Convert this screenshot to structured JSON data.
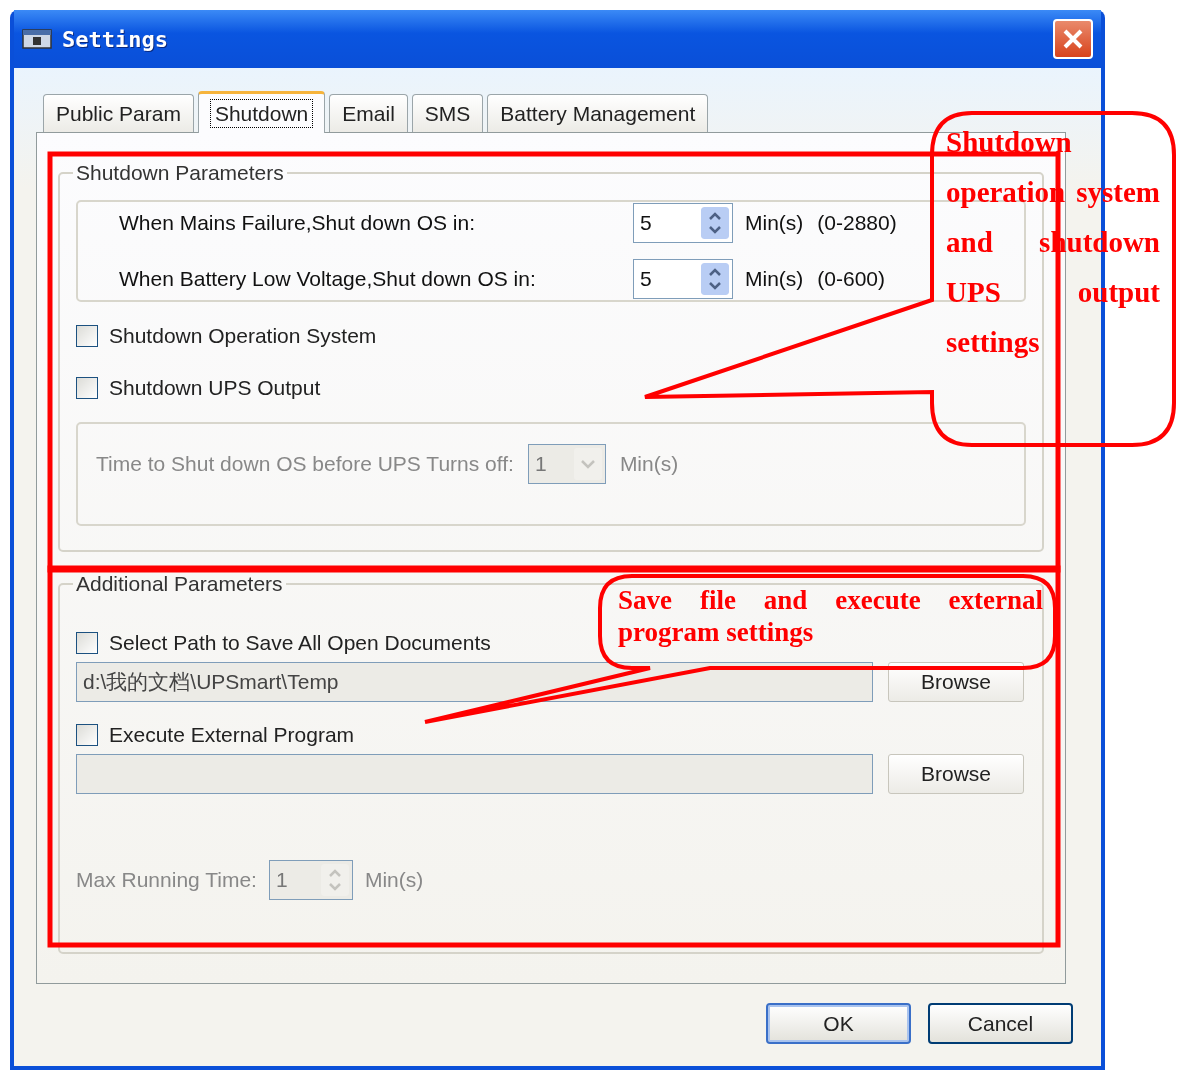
{
  "window": {
    "title": "Settings"
  },
  "tabs": [
    {
      "label": "Public Param",
      "selected": false
    },
    {
      "label": "Shutdown",
      "selected": true
    },
    {
      "label": "Email",
      "selected": false
    },
    {
      "label": "SMS",
      "selected": false
    },
    {
      "label": "Battery Management",
      "selected": false
    }
  ],
  "shutdown_parameters": {
    "title": "Shutdown Parameters",
    "delays": [
      {
        "label": "When Mains Failure,Shut down OS in:",
        "value": "5",
        "unit": "Min(s)",
        "range": "(0-2880)"
      },
      {
        "label": "When Battery Low Voltage,Shut down OS in:",
        "value": "5",
        "unit": "Min(s)",
        "range": "(0-600)"
      }
    ],
    "options": [
      {
        "label": "Shutdown Operation System",
        "checked": false
      },
      {
        "label": "Shutdown UPS Output",
        "checked": false
      }
    ],
    "ups_off_delay": {
      "label": "Time to Shut down OS before UPS Turns off:",
      "value": "1",
      "unit": "Min(s)",
      "disabled": true
    }
  },
  "additional_parameters": {
    "title": "Additional Parameters",
    "save_documents": {
      "label": "Select Path to Save All Open Documents",
      "checked": false,
      "path": "d:\\我的文档\\UPSmart\\Temp",
      "path_disabled": true,
      "browse": "Browse"
    },
    "external_program": {
      "label": "Execute External Program",
      "checked": false,
      "path_disabled": true,
      "browse": "Browse"
    },
    "max_running_time": {
      "label": "Max Running Time:",
      "value": "1",
      "unit": "Min(s)",
      "disabled": true
    }
  },
  "buttons": [
    {
      "label": "OK"
    },
    {
      "label": "Cancel"
    }
  ],
  "annotations": [
    {
      "text": "Shutdown operation system and shutdown UPS output settings"
    },
    {
      "text": "Save file and execute external program settings"
    }
  ]
}
